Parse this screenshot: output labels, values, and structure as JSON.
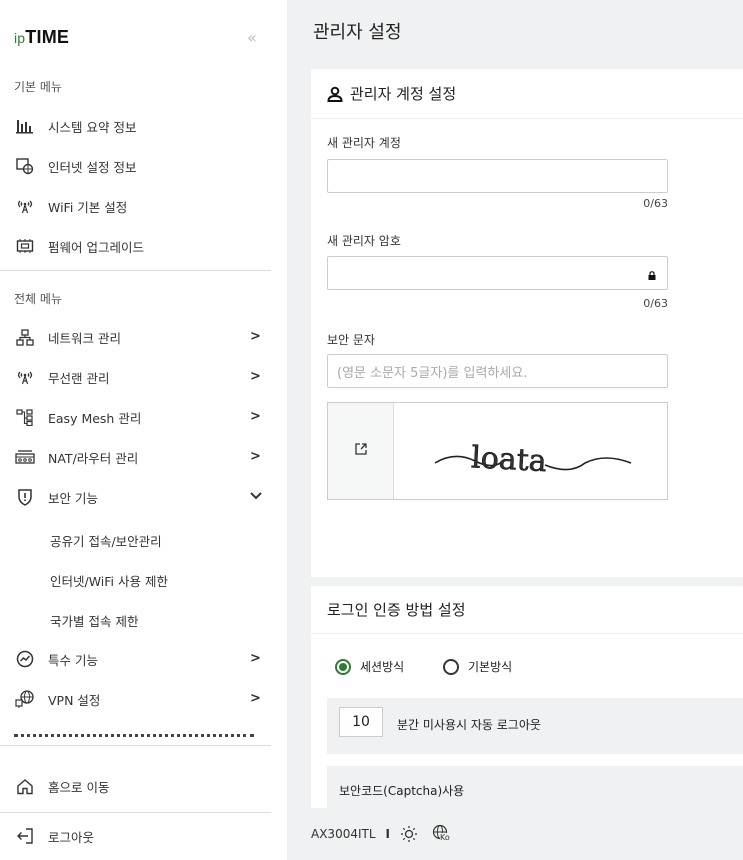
{
  "brand": {
    "ip": "ip",
    "time": "TIME"
  },
  "sidebar": {
    "collapse": "«",
    "basic_title": "기본 메뉴",
    "basic_items": [
      {
        "label": "시스템 요약 정보",
        "icon": "chart-bar-icon"
      },
      {
        "label": "인터넷 설정 정보",
        "icon": "globe-monitor-icon"
      },
      {
        "label": "WiFi 기본 설정",
        "icon": "wifi-antenna-icon"
      },
      {
        "label": "펌웨어 업그레이드",
        "icon": "firmware-icon"
      }
    ],
    "all_title": "전체 메뉴",
    "all_items": [
      {
        "label": "네트워크 관리",
        "icon": "network-icon",
        "chevron": ">"
      },
      {
        "label": "무선랜 관리",
        "icon": "wifi-antenna-icon",
        "chevron": ">"
      },
      {
        "label": "Easy Mesh 관리",
        "icon": "mesh-icon",
        "chevron": ">"
      },
      {
        "label": "NAT/라우터 관리",
        "icon": "router-icon",
        "chevron": ">"
      },
      {
        "label": "보안 기능",
        "icon": "shield-icon",
        "chevron": "v"
      }
    ],
    "security_sub": [
      "공유기 접속/보안관리",
      "인터넷/WiFi 사용 제한",
      "국가별 접속 제한"
    ],
    "more_items": [
      {
        "label": "특수 기능",
        "icon": "special-icon",
        "chevron": ">"
      },
      {
        "label": "VPN 설정",
        "icon": "vpn-icon",
        "chevron": ">"
      }
    ],
    "home": "홈으로 이동",
    "logout": "로그아웃"
  },
  "main": {
    "title": "관리자 설정",
    "account_card": {
      "title": "관리자 계정 설정",
      "new_account_label": "새 관리자 계정",
      "new_account_value": "",
      "new_account_count": "0/63",
      "new_password_label": "새 관리자 암호",
      "new_password_value": "",
      "new_password_count": "0/63",
      "security_label": "보안 문자",
      "security_placeholder": "(영문 소문자 5글자)를 입력하세요.",
      "captcha_text": "loata"
    },
    "login_card": {
      "title": "로그인 인증 방법 설정",
      "radio_session": "세션방식",
      "radio_basic": "기본방식",
      "selected": "세션방식",
      "timeout_value": "10",
      "timeout_label": "분간 미사용시 자동 로그아웃",
      "captcha_use": "보안코드(Captcha)사용"
    }
  },
  "footer": {
    "model": "AX3004ITL",
    "sep": "I",
    "theme_icon": "sun-icon",
    "lang_icon": "globe-ko-icon",
    "lang_code": "Ko"
  },
  "colors": {
    "accent": "#2e7d32",
    "bg": "#f0f1f2"
  }
}
